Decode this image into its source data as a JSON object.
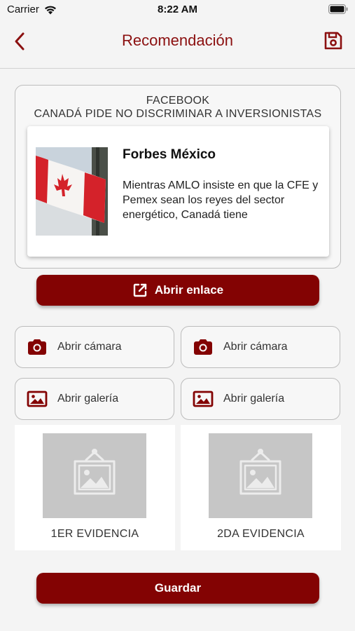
{
  "status_bar": {
    "carrier": "Carrier",
    "time": "8:22 AM"
  },
  "nav": {
    "title": "Recomendación"
  },
  "post": {
    "source": "FACEBOOK",
    "headline": "CANADÁ PIDE NO DISCRIMINAR A INVERSIONISTAS",
    "preview": {
      "publisher": "Forbes México",
      "description": "Mientras AMLO insiste en que la CFE y Pemex sean los reyes del sector energético, Canadá tiene"
    }
  },
  "open_link_button": "Abrir enlace",
  "evidence_actions": [
    {
      "camera": "Abrir cámara",
      "gallery": "Abrir galería"
    },
    {
      "camera": "Abrir cámara",
      "gallery": "Abrir galería"
    }
  ],
  "evidence_slots": [
    "1ER EVIDENCIA",
    "2DA EVIDENCIA"
  ],
  "save_button": "Guardar",
  "colors": {
    "accent": "#830303",
    "title": "#8b1010",
    "background": "#f4f4f4",
    "placeholder": "#c6c6c6"
  },
  "icons": [
    "wifi-icon",
    "battery-icon",
    "back-chevron-icon",
    "save-disk-icon",
    "external-link-icon",
    "camera-icon",
    "image-icon",
    "image-placeholder-icon"
  ]
}
